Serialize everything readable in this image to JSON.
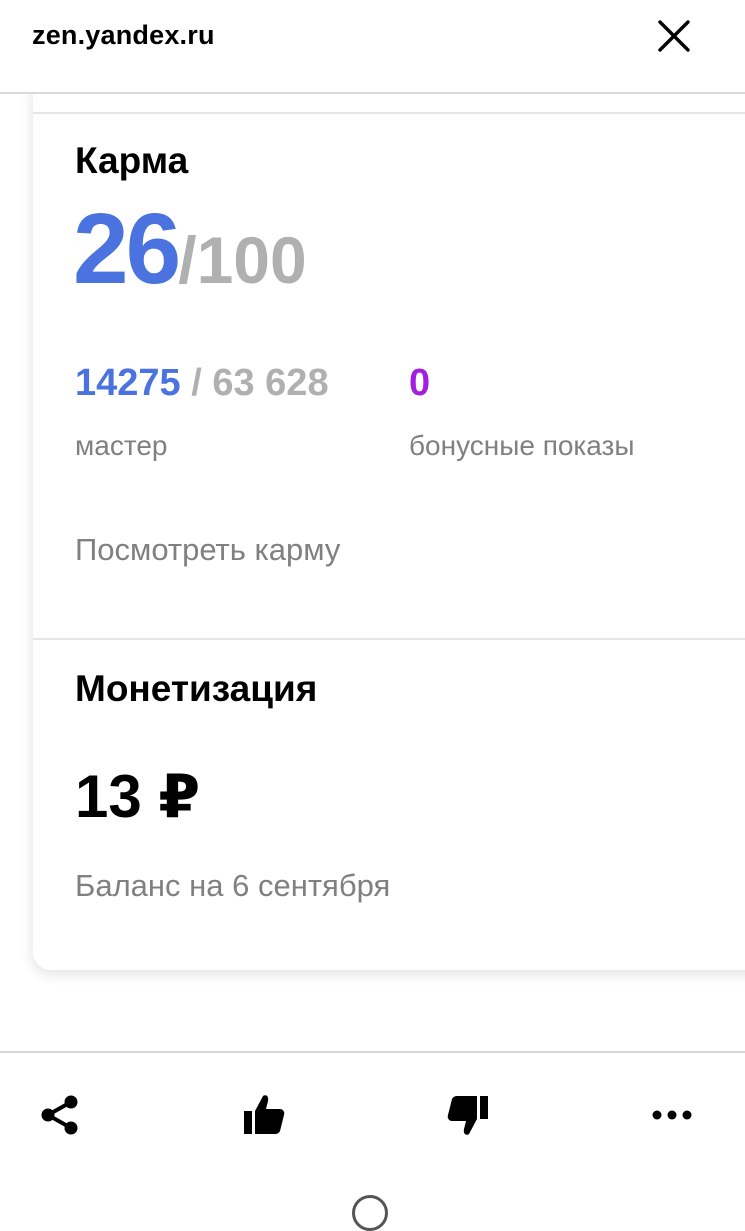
{
  "header": {
    "site_url": "zen.yandex.ru",
    "close_icon": "close-icon"
  },
  "karma": {
    "title": "Карма",
    "score": "26",
    "score_max": "/100",
    "master_value": "14275",
    "master_total": " / 63 628",
    "master_label": "мастер",
    "bonus_value": "0",
    "bonus_label": "бонусные показы",
    "view_link": "Посмотреть карму"
  },
  "monetization": {
    "title": "Монетизация",
    "amount": "13 ₽",
    "balance_label": "Баланс на 6 сентября"
  },
  "bottom_bar": {
    "icons": [
      "share-icon",
      "like-icon",
      "dislike-icon",
      "more-icon"
    ]
  },
  "colors": {
    "accent_blue": "#4a73e0",
    "muted_grey": "#b0b0b0",
    "bonus_purple": "#a21fe0"
  }
}
